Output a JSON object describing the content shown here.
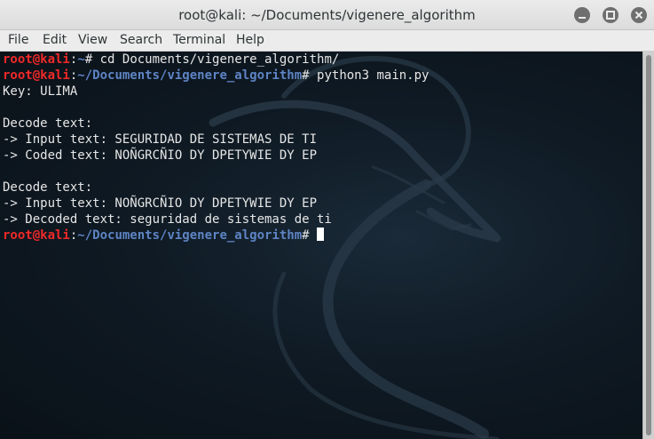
{
  "window": {
    "title": "root@kali: ~/Documents/vigenere_algorithm"
  },
  "menu": {
    "items": [
      "File",
      "Edit",
      "View",
      "Search",
      "Terminal",
      "Help"
    ]
  },
  "terminal": {
    "lines": [
      {
        "type": "prompt",
        "user": "root@kali",
        "sep": ":",
        "path": "~",
        "sym": "#",
        "cmd": " cd Documents/vigenere_algorithm/"
      },
      {
        "type": "prompt",
        "user": "root@kali",
        "sep": ":",
        "path": "~/Documents/vigenere_algorithm",
        "sym": "#",
        "cmd": " python3 main.py"
      },
      {
        "type": "output",
        "text": "Key: ULIMA"
      },
      {
        "type": "output",
        "text": ""
      },
      {
        "type": "output",
        "text": "Decode text:"
      },
      {
        "type": "output",
        "text": "-> Input text: SEGURIDAD DE SISTEMAS DE TI"
      },
      {
        "type": "output",
        "text": "-> Coded text: NOÑGRCÑIO DY DPETYWIE DY EP"
      },
      {
        "type": "output",
        "text": ""
      },
      {
        "type": "output",
        "text": "Decode text:"
      },
      {
        "type": "output",
        "text": "-> Input text: NOÑGRCÑIO DY DPETYWIE DY EP"
      },
      {
        "type": "output",
        "text": "-> Decoded text: seguridad de sistemas de ti"
      },
      {
        "type": "prompt",
        "user": "root@kali",
        "sep": ":",
        "path": "~/Documents/vigenere_algorithm",
        "sym": "#",
        "cmd": " "
      }
    ]
  },
  "colors": {
    "prompt_user": "#ef2929",
    "prompt_path": "#5e84c4",
    "terminal_text": "#e6e6e6",
    "terminal_bg": "#0f1a24"
  }
}
